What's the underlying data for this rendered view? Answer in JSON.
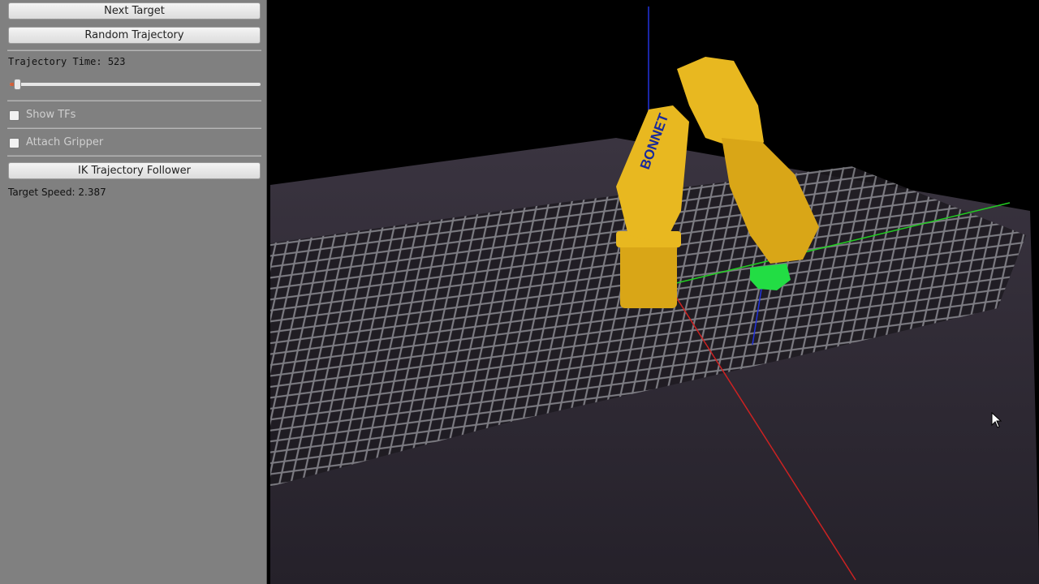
{
  "controls": {
    "next_target_label": "Next Target",
    "random_trajectory_label": "Random Trajectory",
    "trajectory_time_label": "Trajectory Time: 523",
    "trajectory_slider_fraction": 0.03,
    "show_tfs_label": "Show TFs",
    "show_tfs_checked": false,
    "attach_gripper_label": "Attach Gripper",
    "attach_gripper_checked": false,
    "ik_follower_label": "IK Trajectory Follower",
    "target_speed_label": "Target Speed: 2.387"
  },
  "scene": {
    "robot_brand_text": "BONNET",
    "robot_color": "#e8b820",
    "target_color": "#22dd44",
    "axis_x_color": "#cc2222",
    "axis_y_color": "#22cc22",
    "axis_z_color": "#2233dd",
    "background_color": "#000000",
    "floor_color": "#2a2530"
  },
  "icons": {
    "cursor": "mouse-pointer-icon"
  }
}
